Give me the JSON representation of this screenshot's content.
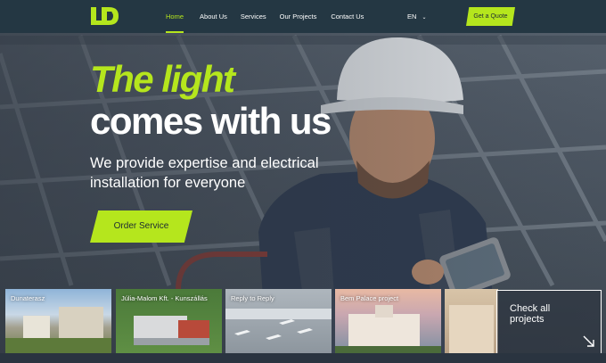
{
  "brand": {
    "logo_text": "LD",
    "accent": "#b5e61d",
    "header_bg": "#243743"
  },
  "nav": {
    "items": [
      {
        "label": "Home",
        "active": true
      },
      {
        "label": "About Us",
        "active": false
      },
      {
        "label": "Services",
        "active": false
      },
      {
        "label": "Our Projects",
        "active": false
      },
      {
        "label": "Contact Us",
        "active": false
      }
    ],
    "language": "EN",
    "cta": "Get a Quote"
  },
  "hero": {
    "title_line1": "The light",
    "title_line2": "comes with us",
    "subtitle": "We provide expertise and electrical installation for everyone",
    "button": "Order Service"
  },
  "projects": {
    "items": [
      {
        "label": "Dunaterasz"
      },
      {
        "label": "Júlia-Malom Kft. - Kunszállás"
      },
      {
        "label": "Reply to Reply"
      },
      {
        "label": "Bem Palace project"
      },
      {
        "label": ""
      }
    ],
    "check_all": "Check all projects"
  }
}
